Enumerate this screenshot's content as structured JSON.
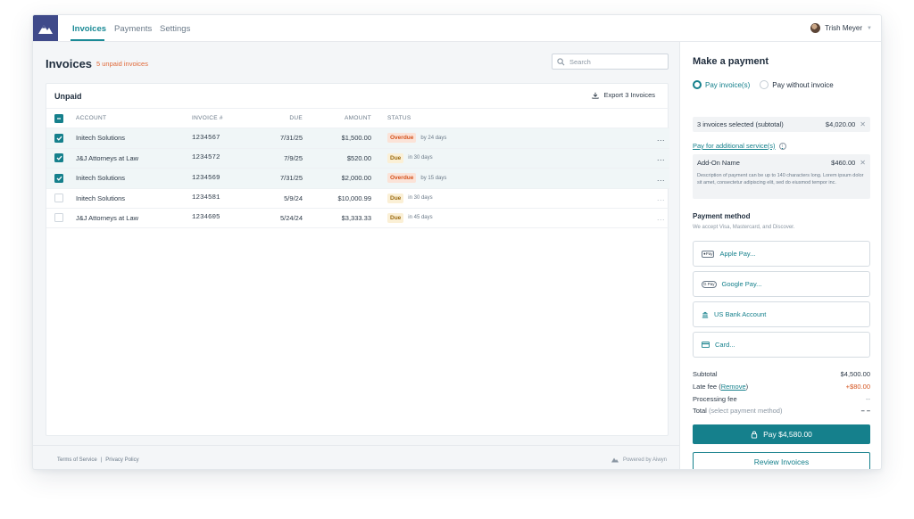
{
  "nav": {
    "tabs": [
      {
        "label": "Invoices",
        "active": true
      },
      {
        "label": "Payments",
        "active": false
      },
      {
        "label": "Settings",
        "active": false
      }
    ],
    "user_name": "Trish Meyer"
  },
  "main": {
    "title": "Invoices",
    "unpaid_count": "5 unpaid invoices",
    "search_placeholder": "Search",
    "section_title": "Unpaid",
    "export_label": "Export 3 Invoices",
    "columns": {
      "account": "ACCOUNT",
      "invoice": "INVOICE #",
      "due": "DUE",
      "amount": "AMOUNT",
      "status": "STATUS"
    },
    "rows": [
      {
        "selected": true,
        "account": "Initech Solutions",
        "invoice": "1234567",
        "due": "7/31/25",
        "amount": "$1,500.00",
        "status": "Overdue",
        "status_note": "by 24 days",
        "more": "..."
      },
      {
        "selected": true,
        "account": "J&J Attorneys at Law",
        "invoice": "1234572",
        "due": "7/9/25",
        "amount": "$520.00",
        "status": "Due",
        "status_note": "in 30 days",
        "more": "..."
      },
      {
        "selected": true,
        "account": "Initech Solutions",
        "invoice": "1234569",
        "due": "7/31/25",
        "amount": "$2,000.00",
        "status": "Overdue",
        "status_note": "by 15 days",
        "more": "..."
      },
      {
        "selected": false,
        "account": "Initech Solutions",
        "invoice": "1234581",
        "due": "5/9/24",
        "amount": "$10,000.99",
        "status": "Due",
        "status_note": "in 30 days",
        "more": "..."
      },
      {
        "selected": false,
        "account": "J&J Attorneys at Law",
        "invoice": "1234605",
        "due": "5/24/24",
        "amount": "$3,333.33",
        "status": "Due",
        "status_note": "in 45 days",
        "more": "..."
      }
    ]
  },
  "footer": {
    "terms": "Terms of Service",
    "separator": "|",
    "privacy": "Privacy Policy",
    "powered": "Powered by Aiwyn"
  },
  "panel": {
    "title": "Make a payment",
    "option_invoice": "Pay invoice(s)",
    "option_no_invoice": "Pay without invoice",
    "selected_label": "3 invoices selected (subtotal)",
    "selected_amount": "$4,020.00",
    "additional_link": "Pay for additional service(s)",
    "addon_name": "Add-On Name",
    "addon_amount": "$460.00",
    "addon_desc": "Description of payment can be up to 140 characters long. Lorem ipsum dolor sit amet, consectetur adipiscing elit, sed do eiusmod tempor inc.",
    "method_title": "Payment method",
    "method_sub": "We accept Visa, Mastercard, and Discover.",
    "methods": [
      "Apple Pay...",
      "Google Pay...",
      "US Bank Account",
      "Card..."
    ],
    "method_icons": {
      "apple": "●Pay",
      "google": "G Pay"
    },
    "subtotal_label": "Subtotal",
    "subtotal_value": "$4,500.00",
    "late_fee_label": "Late fee",
    "late_fee_remove": "Remove",
    "late_fee_value": "+$80.00",
    "processing_label": "Processing fee",
    "processing_value": "--",
    "total_label": "Total",
    "total_note": "(select payment method)",
    "total_value": "– –",
    "pay_label": "Pay $4,580.00",
    "review_label": "Review Invoices"
  },
  "colors": {
    "accent": "#15808c",
    "overdue": "#d4541f",
    "logo_bg": "#3f4a8a"
  }
}
